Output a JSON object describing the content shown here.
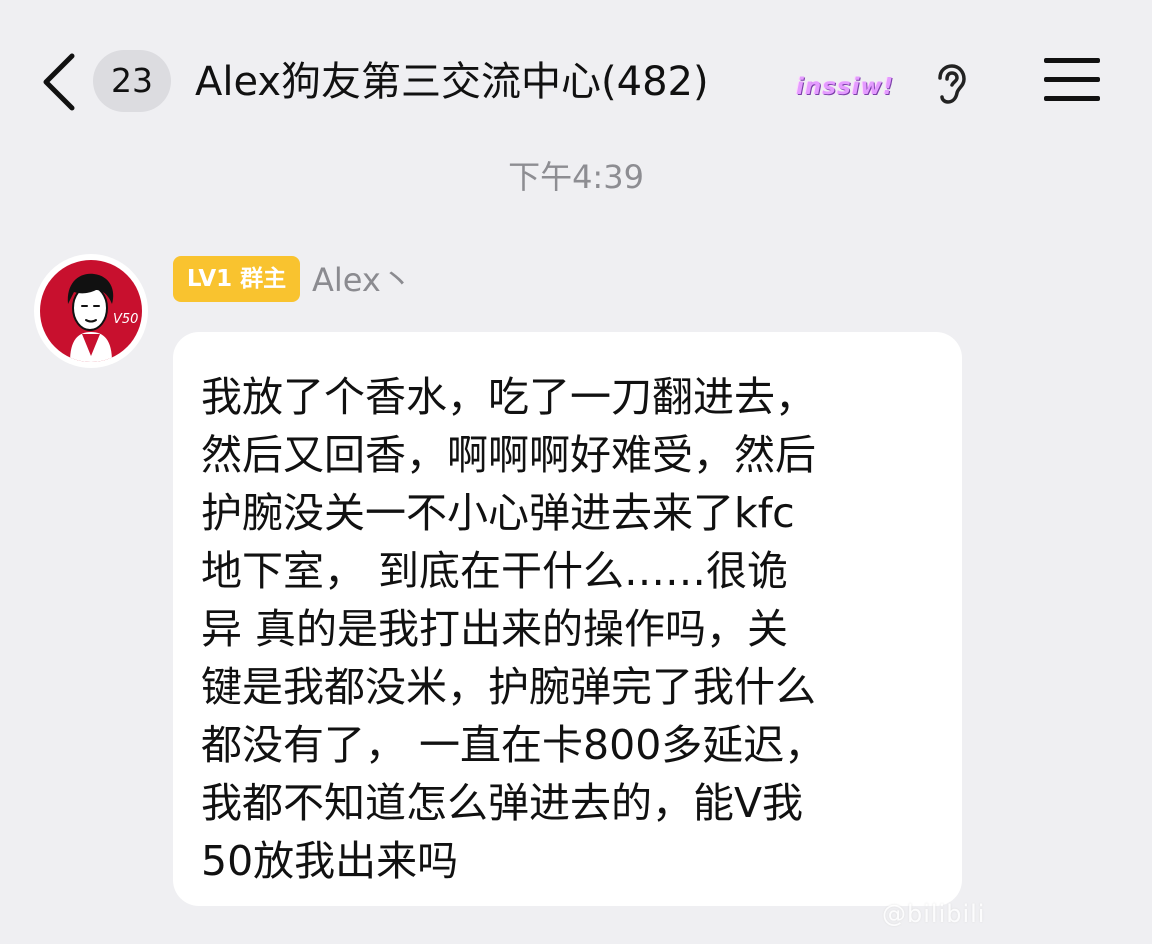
{
  "header": {
    "unread_count": "23",
    "title": "Alex狗友第三交流中心(482)",
    "special_badge": "inssiw!"
  },
  "timestamp": "下午4:39",
  "message": {
    "level_badge": "LV1 群主",
    "sender": "Alex丶",
    "avatar_label": "V50",
    "lines": [
      "我放了个香水，吃了一刀翻进去，",
      "然后又回香，啊啊啊好难受，然后",
      "护腕没关一不小心弹进去来了kfc",
      "地下室，  到底在干什么……很诡",
      "异 真的是我打出来的操作吗，关",
      "键是我都没米，护腕弹完了我什么",
      "都没有了，  一直在卡800多延迟，",
      "我都不知道怎么弹进去的，能V我",
      "50放我出来吗"
    ]
  },
  "watermark": "@bilibili"
}
